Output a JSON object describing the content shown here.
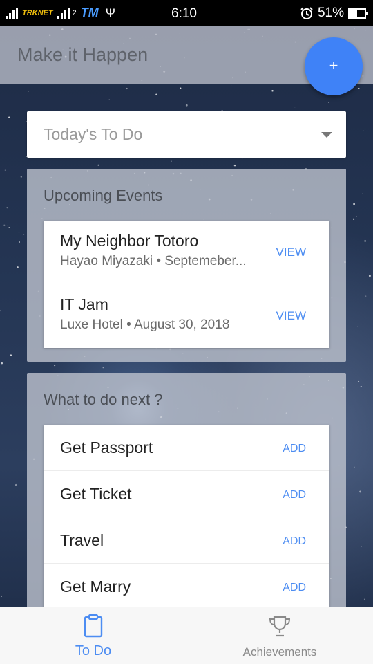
{
  "status_bar": {
    "carrier_1": "TRKNET",
    "sim_2": "2",
    "carrier_2": "TM",
    "time": "6:10",
    "battery": "51%"
  },
  "app": {
    "title": "Make it Happen",
    "fab_label": "+"
  },
  "filter": {
    "selected": "Today's To Do"
  },
  "upcoming": {
    "title": "Upcoming Events",
    "action_label": "VIEW",
    "events": [
      {
        "title": "My Neighbor Totoro",
        "subtitle": "Hayao Miyazaki • Septemeber..."
      },
      {
        "title": "IT Jam",
        "subtitle": "Luxe Hotel • August 30, 2018"
      }
    ]
  },
  "next": {
    "title": "What to do next ?",
    "action_label": "ADD",
    "tasks": [
      {
        "label": "Get Passport"
      },
      {
        "label": "Get Ticket"
      },
      {
        "label": "Travel"
      },
      {
        "label": "Get Marry"
      }
    ]
  },
  "bottom_nav": {
    "items": [
      {
        "label": "To Do",
        "icon": "clipboard-icon",
        "active": true
      },
      {
        "label": "Achievements",
        "icon": "trophy-icon",
        "active": false
      }
    ]
  },
  "colors": {
    "accent": "#4d8df2",
    "fab": "#3f82f7"
  }
}
